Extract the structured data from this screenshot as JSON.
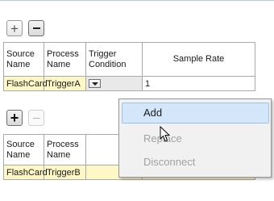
{
  "colors": {
    "highlight_row": "#fff8c6",
    "menu_hover": "#d4e6fa"
  },
  "panel1": {
    "add_button_label": "+",
    "remove_button_label": "−",
    "headers": [
      "Source Name",
      "Process Name",
      "Trigger Condition",
      "Sample Rate"
    ],
    "row": {
      "source_name": "FlashCard",
      "process_name": "TriggerA",
      "trigger_condition": "",
      "sample_rate": "1"
    }
  },
  "panel2": {
    "add_button_label": "+",
    "remove_button_label": "−",
    "headers": [
      "Source Name",
      "Process Name"
    ],
    "row": {
      "source_name": "FlashCard",
      "process_name": "TriggerB"
    }
  },
  "context_menu": {
    "items": [
      {
        "label": "Add",
        "enabled": true,
        "hovered": true
      },
      {
        "label": "Replace",
        "enabled": false
      },
      {
        "label": "Disconnect",
        "enabled": false
      }
    ]
  }
}
